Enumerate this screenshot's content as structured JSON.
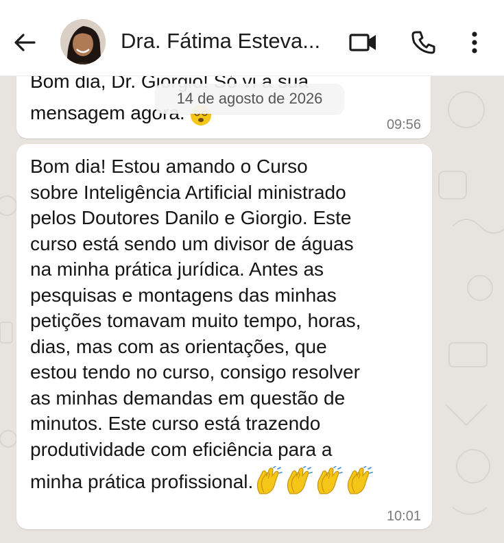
{
  "header": {
    "contact_name": "Dra. Fátima Esteva...",
    "icons": {
      "back": "arrow-left-icon",
      "video": "video-camera-icon",
      "call": "phone-icon",
      "menu": "more-vertical-icon"
    }
  },
  "date_chip": "14 de agosto de 2026",
  "messages": [
    {
      "line1": "Bom dia, Dr. Giorgio! Só vi a sua",
      "line2": "mensagem agora.",
      "emoji": "face-with-spiral-eyes",
      "time": "09:56"
    },
    {
      "lines": [
        "Bom dia! Estou amando o Curso",
        "sobre Inteligência Artificial ministrado",
        "pelos Doutores Danilo e Giorgio. Este",
        "curso está sendo um divisor de águas",
        "na minha prática jurídica. Antes as",
        "pesquisas e montagens das minhas",
        "petições tomavam muito tempo, horas,",
        "dias, mas com as orientações, que",
        "estou tendo no curso, consigo resolver",
        "as minhas demandas em questão de",
        "minutos. Este curso está trazendo",
        "produtividade com eficiência para a",
        "minha prática profissional."
      ],
      "emoji": "clapping-hands",
      "emoji_count": 4,
      "time": "10:01"
    }
  ],
  "colors": {
    "wallpaper": "#e7e4df",
    "bubble": "#ffffff",
    "header": "#ffffff",
    "timestamp": "#7a7a7a",
    "emoji_yellow": "#f5c518"
  }
}
